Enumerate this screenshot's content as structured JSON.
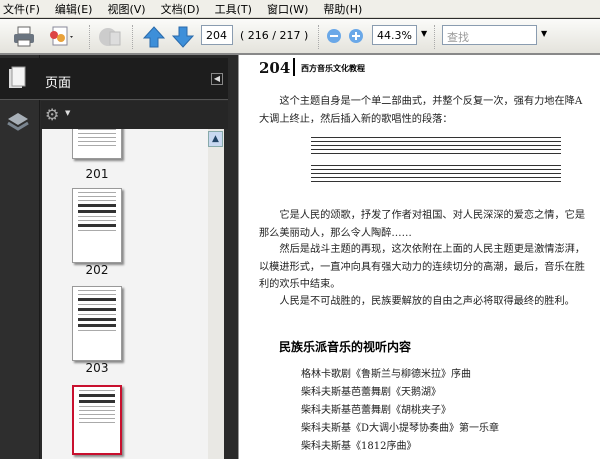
{
  "menu": [
    "文件(F)",
    "编辑(E)",
    "视图(V)",
    "文档(D)",
    "工具(T)",
    "窗口(W)",
    "帮助(H)"
  ],
  "toolbar": {
    "page_input": "204",
    "page_count": "( 216 / 217 )",
    "zoom": "44.3%",
    "search_placeholder": "查找"
  },
  "sidebar": {
    "panel_title": "页面",
    "thumbnails": [
      "201",
      "202",
      "203"
    ],
    "current_page": "204"
  },
  "document": {
    "page_number": "204",
    "running_title": "西方音乐文化教程",
    "paragraphs": [
      "这个主题自身是一个单二部曲式，并整个反复一次，强有力地在降A大调上终止，然后插入新的歌唱性的段落：",
      "它是人民的颂歌，抒发了作者对祖国、对人民深深的爱恋之情，它是那么美丽动人，那么令人陶醉……",
      "然后是战斗主题的再现，这次依附在上面的人民主题更是激情澎湃，以模进形式，一直冲向具有强大动力的连续切分的高潮，最后，音乐在胜利的欢乐中结束。",
      "人民是不可战胜的，民族要解放的自由之声必将取得最终的胜利。"
    ],
    "section_heading": "民族乐派音乐的视听内容",
    "list": [
      "格林卡歌剧《鲁斯兰与柳德米拉》序曲",
      "柴科夫斯基芭蕾舞剧《天鹅湖》",
      "柴科夫斯基芭蕾舞剧《胡桃夹子》",
      "柴科夫斯基《D大调小提琴协奏曲》第一乐章",
      "柴科夫斯基《1812序曲》"
    ]
  },
  "colors": {
    "selection": "#c8102e",
    "toolbar_bg": "#eeede7",
    "sidebar_bg": "#2a2a2a"
  }
}
